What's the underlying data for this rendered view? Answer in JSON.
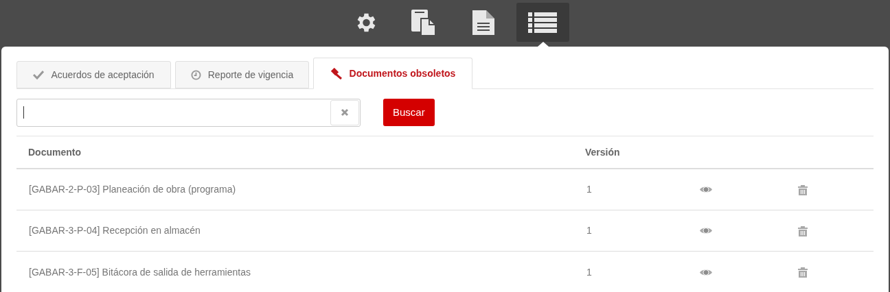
{
  "toolbar": [
    {
      "kind": "gear",
      "selected": false
    },
    {
      "kind": "copy",
      "selected": false
    },
    {
      "kind": "document",
      "selected": false
    },
    {
      "kind": "list",
      "selected": true
    }
  ],
  "tabs": [
    {
      "kind": "check",
      "label": "Acuerdos de aceptación",
      "selected": false
    },
    {
      "kind": "clock",
      "label": "Reporte de vigencia",
      "selected": false
    },
    {
      "kind": "gavel",
      "label": "Documentos obsoletos",
      "selected": true
    }
  ],
  "search": {
    "button": "Buscar"
  },
  "table": {
    "columns": [
      "Documento",
      "Versión"
    ],
    "rows": [
      {
        "document": "[GABAR-2-P-03] Planeación de obra (programa)",
        "version": "1"
      },
      {
        "document": "[GABAR-3-P-04] Recepción en almacén",
        "version": "1"
      },
      {
        "document": "[GABAR-3-F-05] Bitácora de salida de herramientas",
        "version": "1"
      }
    ]
  }
}
